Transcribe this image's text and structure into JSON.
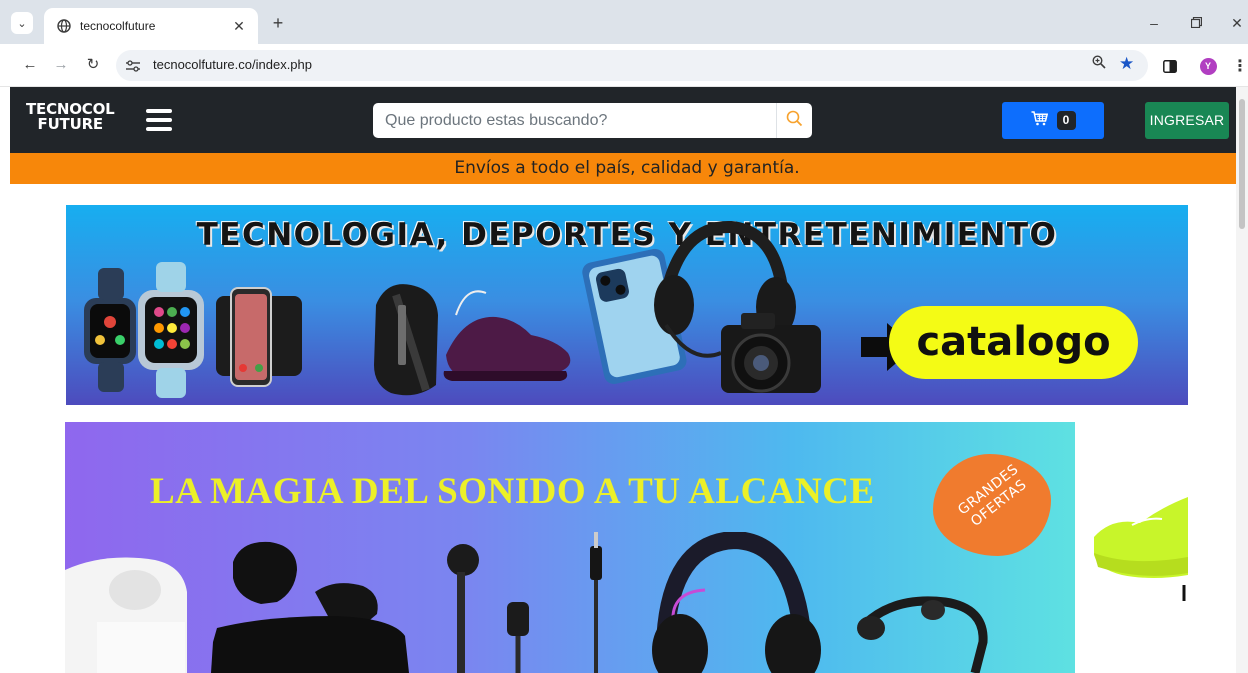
{
  "browser": {
    "tab_title": "tecnocolfuture",
    "url": "tecnocolfuture.co/index.php",
    "profile_initial": "Y",
    "accent_color": "#1a56c7"
  },
  "site": {
    "logo_line1": "TECNOCOL",
    "logo_line2": "FUTURE",
    "search_placeholder": "Que producto estas buscando?",
    "cart_count": "0",
    "login_label": "INGRESAR",
    "shipping_notice": "Envíos a todo el país, calidad y garantía.",
    "colors": {
      "navbar": "#212529",
      "cart_button": "#0d6efd",
      "login_button": "#198754",
      "notice_bar": "#f7870a"
    }
  },
  "banners": [
    {
      "headline": "TECNOLOGIA, DEPORTES Y ENTRETENIMIENTO",
      "cta": "catalogo"
    },
    {
      "headline": "LA MAGIA DEL SONIDO A TU ALCANCE",
      "badge": "GRANDES OFERTAS"
    }
  ]
}
